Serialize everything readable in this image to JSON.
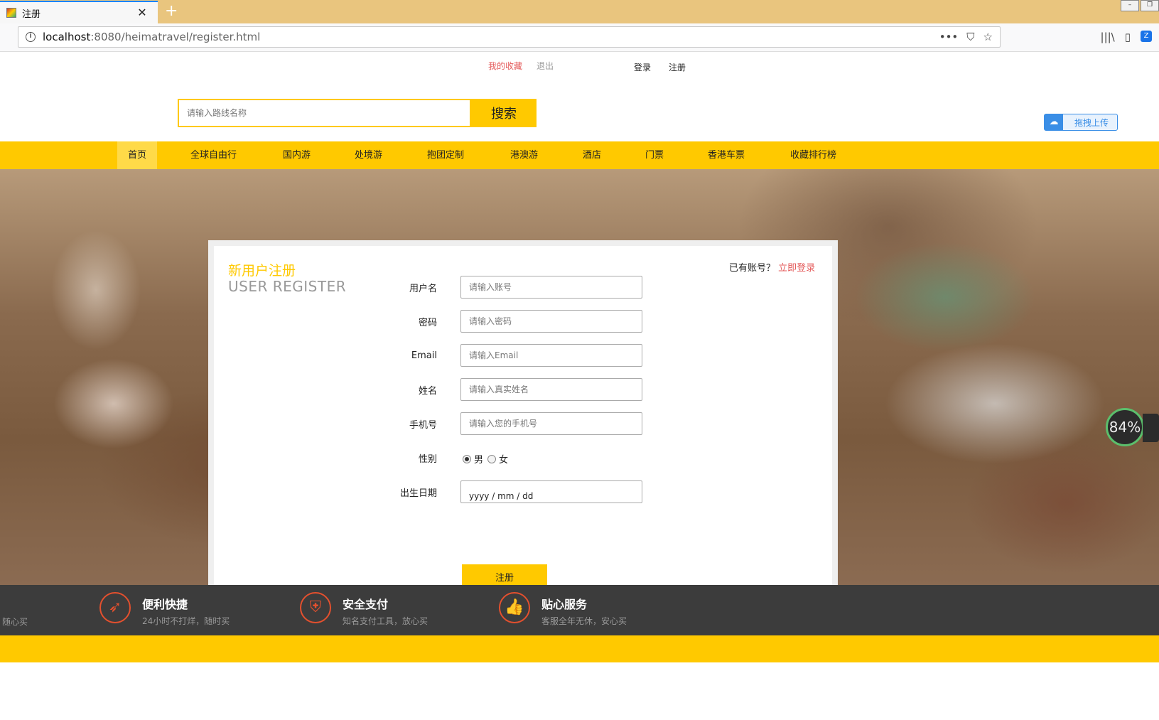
{
  "browser": {
    "tab_title": "注册",
    "url_host": "localhost",
    "url_rest": ":8080/heimatravel/register.html",
    "url_actions": [
      "•••",
      "⛉",
      "☆"
    ],
    "toolbar_icons": [
      "|||\\",
      "▯"
    ]
  },
  "header": {
    "my_favorites": "我的收藏",
    "logout": "退出",
    "login": "登录",
    "register": "注册",
    "search_placeholder": "请输入路线名称",
    "search_button": "搜索",
    "upload_label": "拖拽上传"
  },
  "nav": [
    {
      "label": "首页",
      "active": true
    },
    {
      "label": "全球自由行"
    },
    {
      "label": "国内游"
    },
    {
      "label": "处境游"
    },
    {
      "label": "抱团定制"
    },
    {
      "label": "港澳游"
    },
    {
      "label": "酒店"
    },
    {
      "label": "门票"
    },
    {
      "label": "香港车票"
    },
    {
      "label": "收藏排行榜"
    }
  ],
  "register": {
    "title_cn": "新用户注册",
    "title_en": "USER REGISTER",
    "have_account": "已有账号？",
    "login_now": "立即登录",
    "fields": {
      "username": {
        "label": "用户名",
        "placeholder": "请输入账号"
      },
      "password": {
        "label": "密码",
        "placeholder": "请输入密码"
      },
      "email": {
        "label": "Email",
        "placeholder": "请输入Email"
      },
      "name": {
        "label": "姓名",
        "placeholder": "请输入真实姓名"
      },
      "phone": {
        "label": "手机号",
        "placeholder": "请输入您的手机号"
      },
      "gender": {
        "label": "性别",
        "options": [
          "男",
          "女"
        ],
        "selected": "男"
      },
      "birthday": {
        "label": "出生日期",
        "value": "yyyy / mm / dd"
      }
    },
    "submit": "注册"
  },
  "features": {
    "cut_text": "随心买",
    "items": [
      {
        "title": "便利快捷",
        "desc": "24小时不打烊，随时买",
        "icon": "rocket-icon"
      },
      {
        "title": "安全支付",
        "desc": "知名支付工具，放心买",
        "icon": "shield-icon"
      },
      {
        "title": "贴心服务",
        "desc": "客服全年无休，安心买",
        "icon": "thumbs-up-icon"
      }
    ]
  },
  "widget": {
    "speed": "84%"
  },
  "colors": {
    "accent": "#ffc900",
    "link_red": "#e45a5a",
    "footer_bg": "#3c3c3c"
  }
}
